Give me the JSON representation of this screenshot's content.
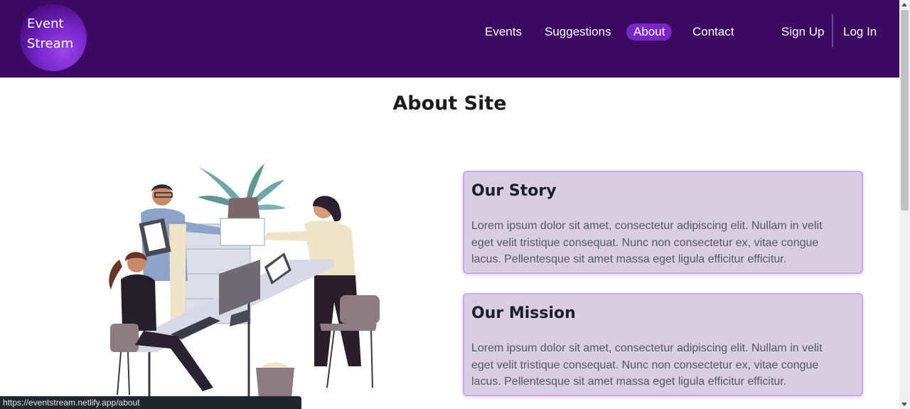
{
  "brand": {
    "line1": "Event",
    "line2": "Stream"
  },
  "nav": {
    "events": "Events",
    "suggestions": "Suggestions",
    "about": "About",
    "contact": "Contact",
    "signup": "Sign Up",
    "login": "Log In"
  },
  "page": {
    "title": "About Site"
  },
  "story": {
    "title": "Our Story",
    "text": "Lorem ipsum dolor sit amet, consectetur adipiscing elit. Nullam in velit eget velit tristique consequat. Nunc non consectetur ex, vitae congue lacus. Pellentesque sit amet massa eget ligula efficitur efficitur."
  },
  "mission": {
    "title": "Our Mission",
    "text": "Lorem ipsum dolor sit amet, consectetur adipiscing elit. Nullam in velit eget velit tristique consequat. Nunc non consectetur ex, vitae congue lacus. Pellentesque sit amet massa eget ligula efficitur efficitur."
  },
  "status": {
    "url": "https://eventstream.netlify.app/about"
  },
  "colors": {
    "nav_bg": "#3d0a63",
    "active_pill": "#7b25c9",
    "card_bg": "#d9cde2",
    "card_border": "#c9a8ef"
  }
}
